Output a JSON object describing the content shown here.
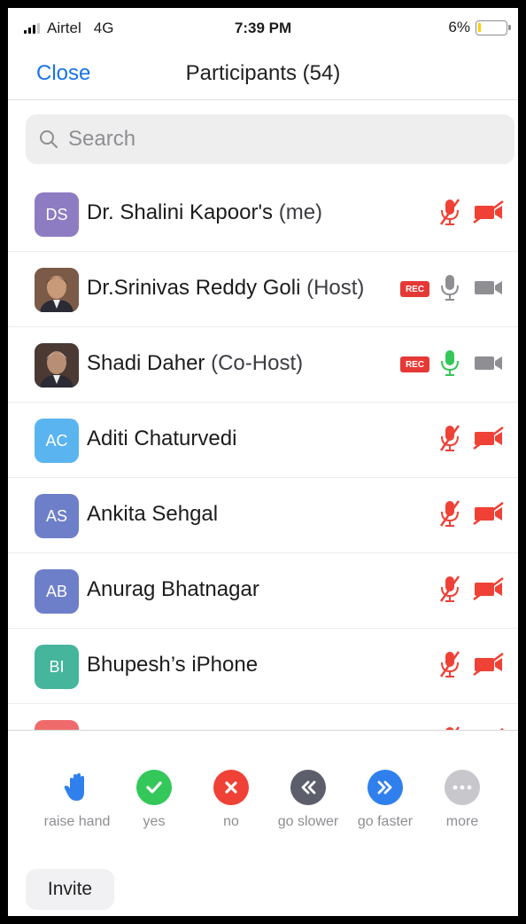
{
  "status_bar": {
    "carrier": "Airtel",
    "network": "4G",
    "time": "7:39 PM",
    "battery": "6%"
  },
  "nav": {
    "close_label": "Close",
    "title": "Participants (54)"
  },
  "search": {
    "placeholder": "Search"
  },
  "participants": [
    {
      "initials": "DS",
      "name": "Dr. Shalini Kapoor's",
      "role": "(me)",
      "avatar_color": "#8e7cc3",
      "recording": false,
      "mic": "muted",
      "video": "off"
    },
    {
      "initials": "",
      "name": "Dr.Srinivas Reddy Goli",
      "role": "(Host)",
      "avatar_color": "#7b5a48",
      "recording": true,
      "rec_label": "REC",
      "mic": "on",
      "video": "on",
      "photo": true
    },
    {
      "initials": "",
      "name": "Shadi Daher",
      "role": "(Co-Host)",
      "avatar_color": "#4a3a33",
      "recording": true,
      "rec_label": "REC",
      "mic": "active",
      "video": "on",
      "photo": true
    },
    {
      "initials": "AC",
      "name": "Aditi Chaturvedi",
      "role": "",
      "avatar_color": "#5ab4f0",
      "recording": false,
      "mic": "muted",
      "video": "off"
    },
    {
      "initials": "AS",
      "name": "Ankita Sehgal",
      "role": "",
      "avatar_color": "#6e7fc9",
      "recording": false,
      "mic": "muted",
      "video": "off"
    },
    {
      "initials": "AB",
      "name": "Anurag Bhatnagar",
      "role": "",
      "avatar_color": "#6e7fc9",
      "recording": false,
      "mic": "muted",
      "video": "off"
    },
    {
      "initials": "BI",
      "name": "Bhupesh’s iPhone",
      "role": "",
      "avatar_color": "#45b59c",
      "recording": false,
      "mic": "muted",
      "video": "off"
    },
    {
      "initials": "",
      "name": "",
      "role": "",
      "avatar_color": "#ef6b6b",
      "recording": false,
      "mic": "muted",
      "video": "off"
    }
  ],
  "reactions": [
    {
      "label": "raise hand",
      "color": "#2f80ed",
      "icon": "raise-hand-icon"
    },
    {
      "label": "yes",
      "color": "#34c759",
      "icon": "check-icon"
    },
    {
      "label": "no",
      "color": "#ef4136",
      "icon": "x-icon"
    },
    {
      "label": "go slower",
      "color": "#5c5f6b",
      "icon": "rewind-icon"
    },
    {
      "label": "go faster",
      "color": "#2f80ed",
      "icon": "fast-forward-icon"
    },
    {
      "label": "more",
      "color": "#c7c7cc",
      "icon": "more-icon"
    }
  ],
  "invite_label": "Invite",
  "colors": {
    "accent": "#1a73e8",
    "muted_red": "#ef4136",
    "mic_active": "#34c759",
    "icon_gray": "#8e8e93"
  }
}
